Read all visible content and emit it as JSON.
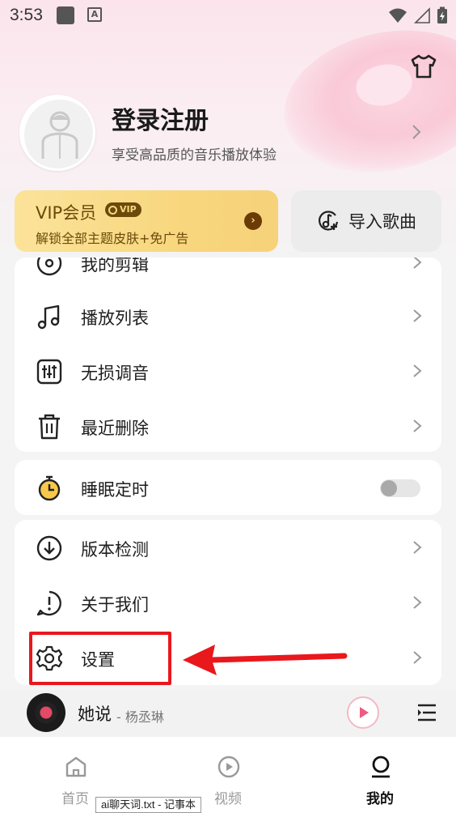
{
  "status": {
    "time": "3:53"
  },
  "profile": {
    "title": "登录注册",
    "subtitle": "享受高品质的音乐播放体验"
  },
  "vip": {
    "title": "VIP会员",
    "badge": "VIP",
    "subtitle": "解锁全部主题皮肤+免广告"
  },
  "import": {
    "label": "导入歌曲"
  },
  "menu_group_1": [
    {
      "label": "我的剪辑",
      "icon": "disc-icon"
    },
    {
      "label": "播放列表",
      "icon": "music-note-icon"
    },
    {
      "label": "无损调音",
      "icon": "equalizer-icon"
    },
    {
      "label": "最近删除",
      "icon": "trash-icon"
    }
  ],
  "sleep_timer": {
    "label": "睡眠定时",
    "enabled": false
  },
  "menu_group_3": [
    {
      "label": "版本检测",
      "icon": "download-circle-icon"
    },
    {
      "label": "关于我们",
      "icon": "info-circle-icon"
    },
    {
      "label": "设置",
      "icon": "gear-icon"
    }
  ],
  "player": {
    "song": "她说",
    "artist": "- 杨丞琳"
  },
  "tabs": [
    {
      "label": "首页",
      "icon": "home-icon",
      "active": false
    },
    {
      "label": "视频",
      "icon": "play-circle-icon",
      "active": false
    },
    {
      "label": "我的",
      "icon": "profile-icon",
      "active": true
    }
  ],
  "tooltip": {
    "text": "ai聊天词.txt - 记事本"
  },
  "colors": {
    "accent_red": "#e8181d",
    "vip_gold": "#f8d77f",
    "vip_brown": "#6b4a0a"
  }
}
